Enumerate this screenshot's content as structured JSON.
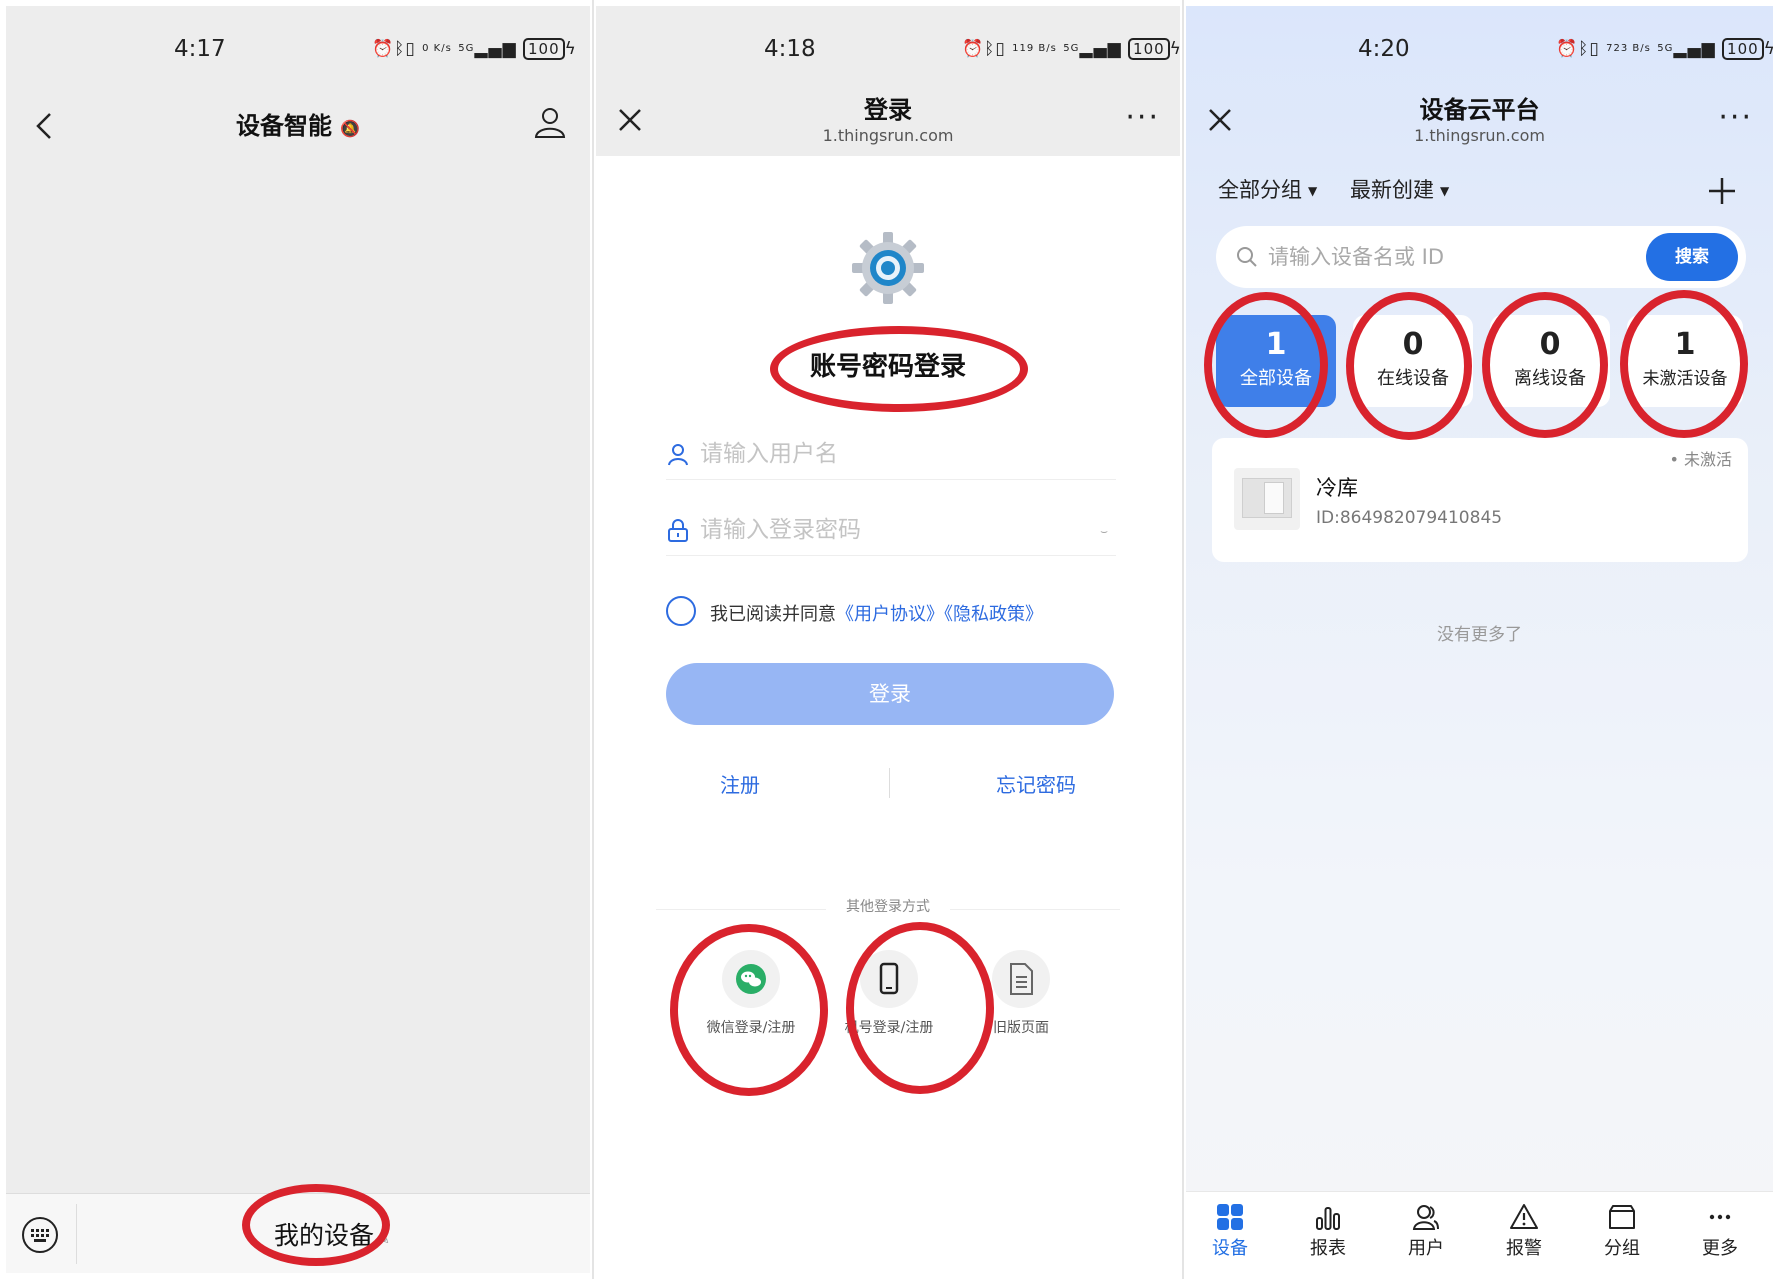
{
  "panels": {
    "p1": {
      "status": {
        "time": "4:17",
        "net_speed": "0 K/s",
        "signal": "5G",
        "battery": "100"
      },
      "title": "设备智能",
      "bottom_menu": "我的设备"
    },
    "p2": {
      "status": {
        "time": "4:18",
        "net_speed": "119 B/s",
        "signal": "5G",
        "battery": "100"
      },
      "title": "登录",
      "url": "1.thingsrun.com",
      "heading": "账号密码登录",
      "username_placeholder": "请输入用户名",
      "password_placeholder": "请输入登录密码",
      "agree_text": "我已阅读并同意",
      "user_agreement": "《用户协议》",
      "privacy_policy": "《隐私政策》",
      "login_button": "登录",
      "register_link": "注册",
      "forgot_link": "忘记密码",
      "other_methods_label": "其他登录方式",
      "alt_logins": [
        {
          "label": "微信登录/注册",
          "icon": "wechat-icon"
        },
        {
          "label": "机号登录/注册",
          "icon": "phone-icon"
        },
        {
          "label": "旧版页面",
          "icon": "document-icon"
        }
      ]
    },
    "p3": {
      "status": {
        "time": "4:20",
        "net_speed": "723 B/s",
        "signal": "5G",
        "battery": "100"
      },
      "title": "设备云平台",
      "url": "1.thingsrun.com",
      "filter_group": "全部分组",
      "filter_sort": "最新创建",
      "search_placeholder": "请输入设备名或 ID",
      "search_button": "搜索",
      "stats": [
        {
          "count": "1",
          "label": "全部设备"
        },
        {
          "count": "0",
          "label": "在线设备"
        },
        {
          "count": "0",
          "label": "离线设备"
        },
        {
          "count": "1",
          "label": "未激活设备"
        }
      ],
      "device": {
        "name": "冷库",
        "id": "ID:864982079410845",
        "status": "• 未激活"
      },
      "no_more": "没有更多了",
      "tabs": [
        {
          "label": "设备",
          "icon": "grid-icon"
        },
        {
          "label": "报表",
          "icon": "bar-chart-icon"
        },
        {
          "label": "用户",
          "icon": "users-icon"
        },
        {
          "label": "报警",
          "icon": "warning-icon"
        },
        {
          "label": "分组",
          "icon": "folder-icon"
        },
        {
          "label": "更多",
          "icon": "more-dots-icon"
        }
      ]
    }
  },
  "colors": {
    "accent": "#2370e4",
    "annotation": "#d9232d",
    "login_button": "#97b6f4"
  }
}
